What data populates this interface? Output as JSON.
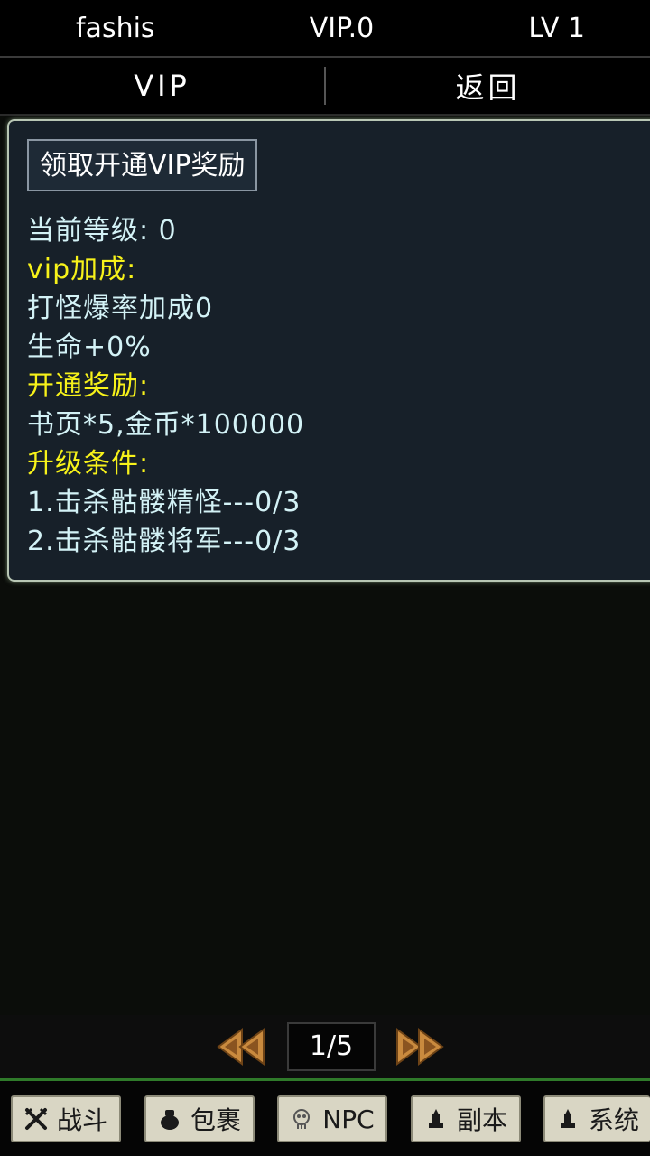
{
  "status": {
    "name": "fashis",
    "vip": "VIP.0",
    "level": "LV 1"
  },
  "nav": {
    "tab_vip": "VIP",
    "tab_back": "返回"
  },
  "panel": {
    "claim_button": "领取开通VIP奖励",
    "lines": [
      {
        "text": "当前等级: 0",
        "color": "cyan"
      },
      {
        "text": "vip加成:",
        "color": "yellow"
      },
      {
        "text": "打怪爆率加成0",
        "color": "cyan"
      },
      {
        "text": "生命+0%",
        "color": "cyan"
      },
      {
        "text": "开通奖励:",
        "color": "yellow"
      },
      {
        "text": "书页*5,金币*100000",
        "color": "cyan"
      },
      {
        "text": "升级条件:",
        "color": "yellow"
      },
      {
        "text": "1.击杀骷髅精怪---0/3",
        "color": "cyan"
      },
      {
        "text": "2.击杀骷髅将军---0/3",
        "color": "cyan"
      }
    ]
  },
  "pager": {
    "page": "1/5",
    "prev_icon": "double-arrow-left-icon",
    "next_icon": "double-arrow-right-icon"
  },
  "bottom_nav": {
    "battle": "战斗",
    "bag": "包裹",
    "npc": "NPC",
    "dungeon": "副本",
    "system": "系统",
    "icons": [
      "crossed-swords-icon",
      "bag-icon",
      "skull-icon",
      "tower-icon",
      "tower-icon"
    ]
  },
  "colors": {
    "cyan_text": "#d3f2f6",
    "yellow_text": "#f7f21a",
    "panel_bg": "#172029",
    "green_divider": "#2f7a2a"
  }
}
